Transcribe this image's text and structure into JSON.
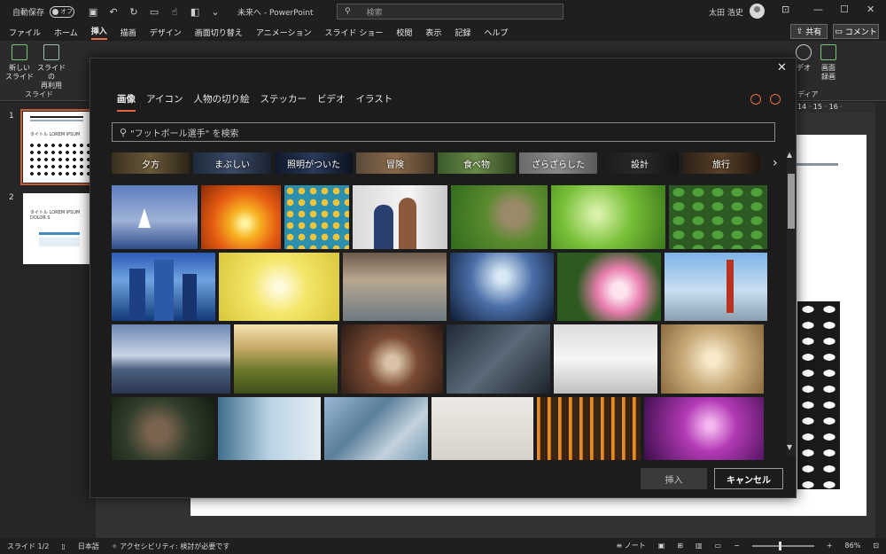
{
  "titlebar": {
    "autosave_label": "自動保存",
    "autosave_state": "オフ",
    "doc_title": "未来へ  -  PowerPoint",
    "search_placeholder": "検索",
    "user_name": "太田 浩史"
  },
  "ribbon": {
    "tabs": [
      "ファイル",
      "ホーム",
      "挿入",
      "描画",
      "デザイン",
      "画面切り替え",
      "アニメーション",
      "スライド ショー",
      "校閲",
      "表示",
      "記録",
      "ヘルプ"
    ],
    "active_tab": "挿入",
    "share": "共有",
    "comment": "コメント",
    "new_slide": "新しい\nスライド",
    "reuse_slide": "スライドの\n再利用",
    "group_slides": "スライド",
    "screen_record": "画面\n録画",
    "video_partial": "デオ",
    "group_media": "ディア"
  },
  "slides": [
    {
      "number": "1",
      "title": "タイトル LOREM IPSUM"
    },
    {
      "number": "2",
      "title": "タイトル LOREM IPSUM DOLOR S"
    }
  ],
  "ruler": {
    "marks": "14 · 15 · 16 ·"
  },
  "dialog": {
    "tabs": [
      "画像",
      "アイコン",
      "人物の切り絵",
      "ステッカー",
      "ビデオ",
      "イラスト"
    ],
    "active_tab": "画像",
    "search_placeholder": "\"フットボール選手\" を検索",
    "chips": [
      "夕方",
      "まぶしい",
      "照明がついた",
      "冒険",
      "食べ物",
      "ざらざらした",
      "設計",
      "旅行"
    ],
    "insert_button": "挿入",
    "cancel_button": "キャンセル"
  },
  "status": {
    "slide_count": "スライド 1/2",
    "language": "日本語",
    "accessibility": "アクセシビリティ: 検討が必要です",
    "notes": "ノート",
    "zoom": "86%"
  },
  "colors": {
    "accent": "#e7663f",
    "dialog_bg": "#1c1c1c",
    "app_bg": "#1f1f1f"
  }
}
